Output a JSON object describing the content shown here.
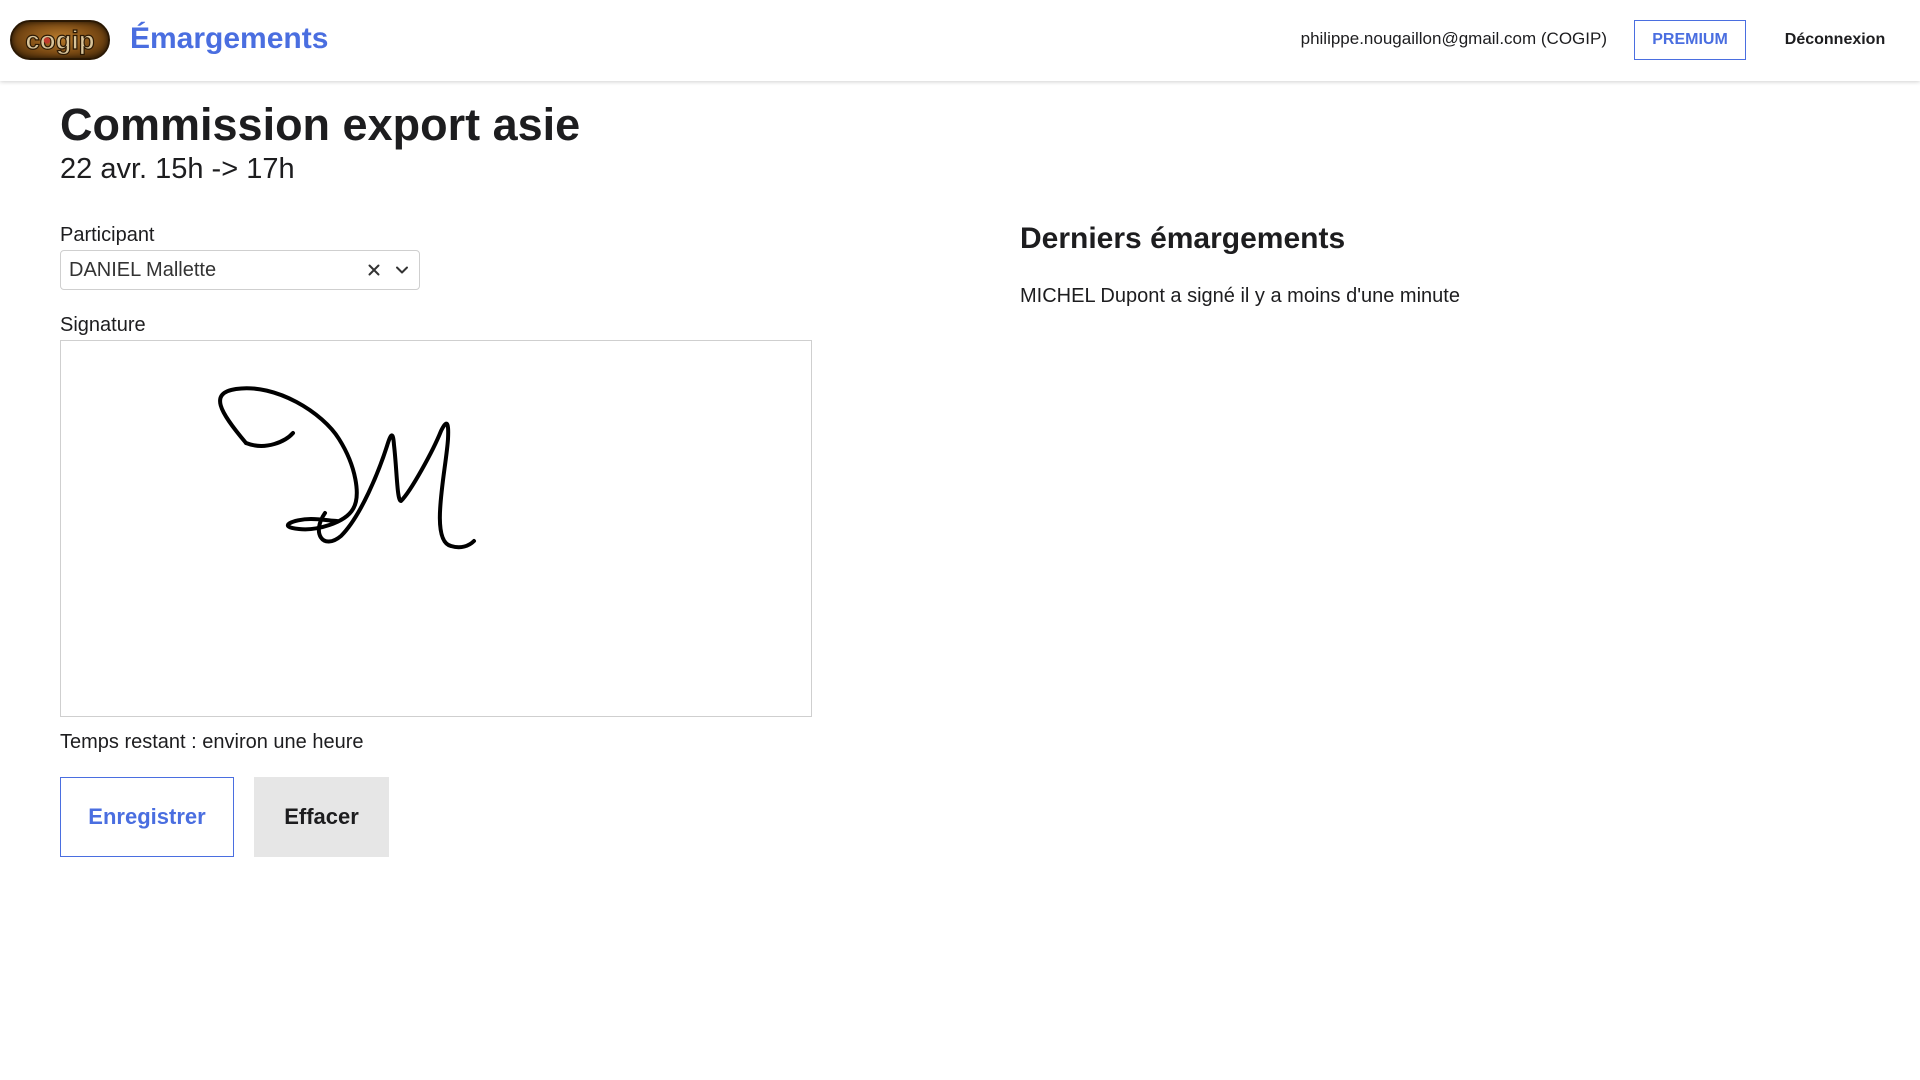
{
  "header": {
    "logo_text": "cogip",
    "app_title": "Émargements",
    "user_email": "philippe.nougaillon@gmail.com (COGIP)",
    "premium_label": "PREMIUM",
    "logout_label": "Déconnexion"
  },
  "session": {
    "title": "Commission export asie",
    "schedule": "22 avr. 15h -> 17h"
  },
  "form": {
    "participant_label": "Participant",
    "participant_value": "DANIEL Mallette",
    "signature_label": "Signature",
    "time_remaining": "Temps restant : environ une heure",
    "save_label": "Enregistrer",
    "clear_label": "Effacer"
  },
  "recent": {
    "title": "Derniers émargements",
    "items": [
      "MICHEL Dupont a signé il y a moins d'une minute"
    ]
  },
  "colors": {
    "accent": "#4a6ee0",
    "text": "#1d1d1f",
    "secondary_button_bg": "#e6e6e6"
  },
  "icons": {
    "clear": "close-icon",
    "dropdown": "chevron-down-icon"
  }
}
